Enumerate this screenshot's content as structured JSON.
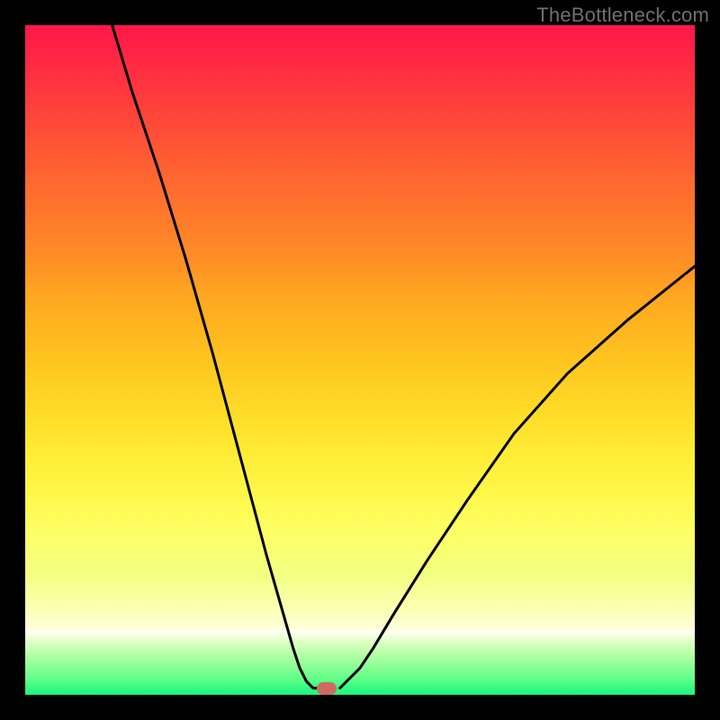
{
  "watermark": "TheBottleneck.com",
  "chart_data": {
    "type": "line",
    "title": "",
    "xlabel": "",
    "ylabel": "",
    "xlim": [
      0,
      100
    ],
    "ylim": [
      0,
      100
    ],
    "grid": false,
    "series": [
      {
        "name": "left-branch",
        "x": [
          13,
          16,
          20,
          24,
          28,
          32,
          36,
          38,
          40,
          41,
          42,
          43,
          44
        ],
        "values": [
          100,
          90,
          78,
          65,
          51,
          36,
          21,
          14,
          7,
          4,
          2,
          1,
          1
        ]
      },
      {
        "name": "right-branch",
        "x": [
          47,
          48,
          49,
          50,
          52,
          55,
          60,
          66,
          73,
          81,
          90,
          100
        ],
        "values": [
          1,
          2,
          3,
          4,
          7,
          12,
          20,
          29,
          39,
          48,
          56,
          64
        ]
      }
    ],
    "annotations": [
      {
        "name": "valley-marker",
        "x": 45,
        "y": 1
      }
    ],
    "background": {
      "type": "vertical-gradient",
      "stops": [
        {
          "pos": 0,
          "color": "#ff1748"
        },
        {
          "pos": 50,
          "color": "#ffca21"
        },
        {
          "pos": 75,
          "color": "#fdff66"
        },
        {
          "pos": 90,
          "color": "#feffdc"
        },
        {
          "pos": 100,
          "color": "#1ef57e"
        }
      ]
    }
  },
  "colors": {
    "frame": "#000000",
    "curve": "#000000",
    "marker": "#cf6a62",
    "watermark": "#707070"
  }
}
